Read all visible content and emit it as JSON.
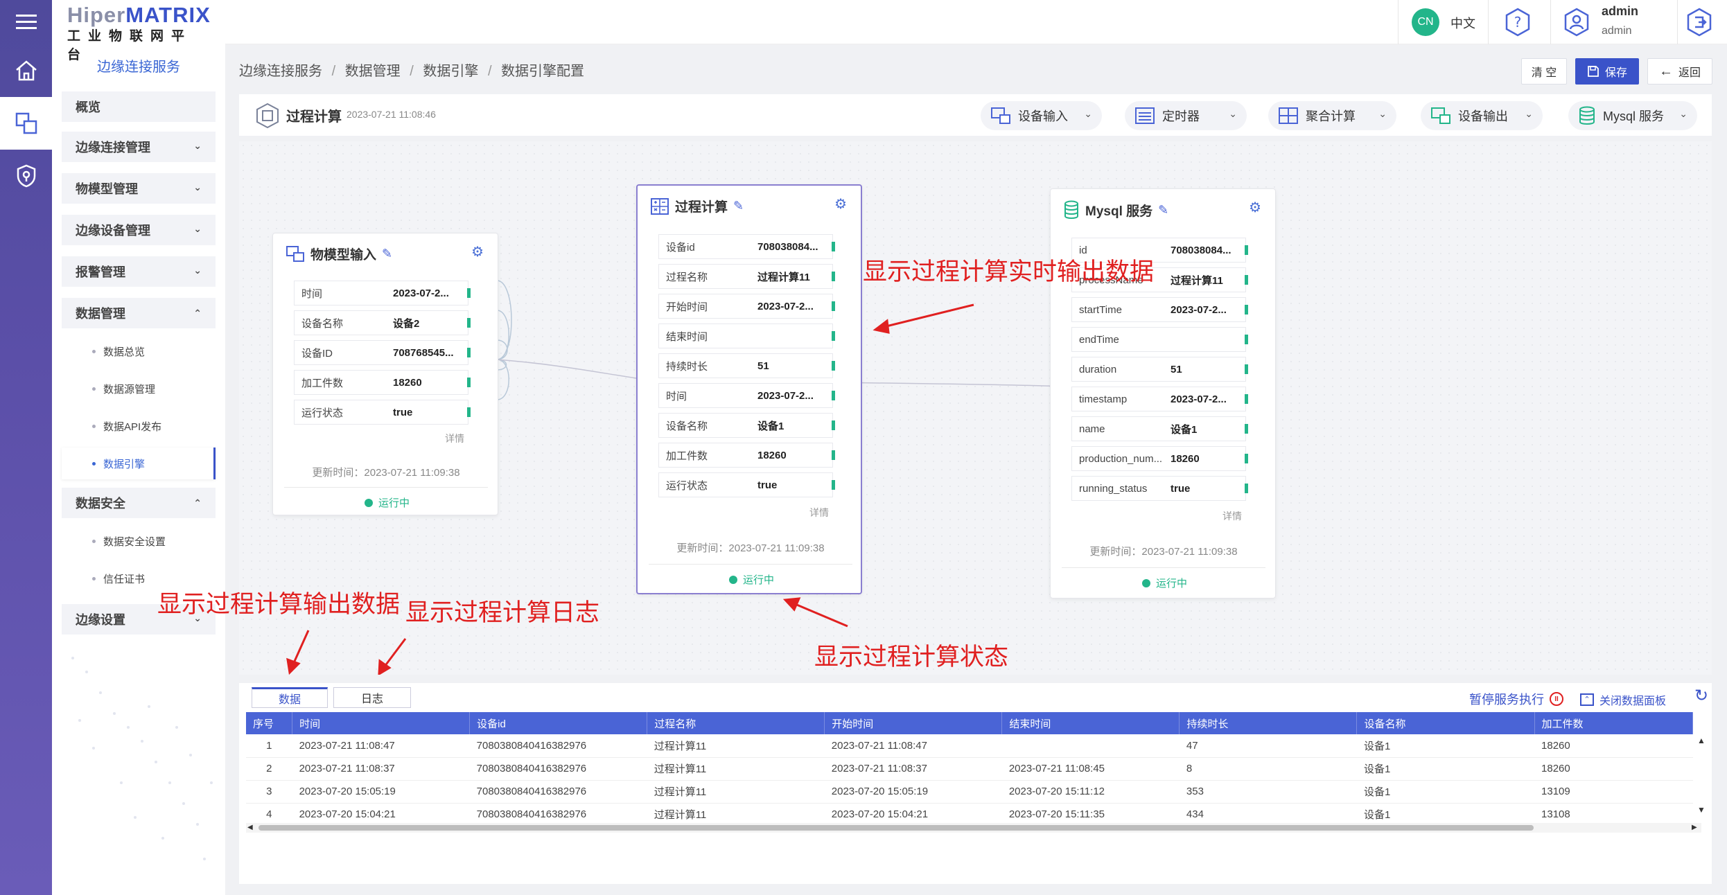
{
  "brand": {
    "name_a": "Hiper",
    "name_b": "MATRIX",
    "subtitle": "工业物联网平台"
  },
  "sidebar": {
    "service_title": "边缘连接服务",
    "items": [
      {
        "label": "概览"
      },
      {
        "label": "边缘连接管理"
      },
      {
        "label": "物模型管理"
      },
      {
        "label": "边缘设备管理"
      },
      {
        "label": "报警管理"
      },
      {
        "label": "数据管理"
      },
      {
        "label": "数据安全"
      },
      {
        "label": "边缘设置"
      }
    ],
    "data_sub": [
      {
        "label": "数据总览"
      },
      {
        "label": "数据源管理"
      },
      {
        "label": "数据API发布"
      },
      {
        "label": "数据引擎"
      }
    ],
    "sec_sub": [
      {
        "label": "数据安全设置"
      },
      {
        "label": "信任证书"
      }
    ]
  },
  "header": {
    "lang_badge": "CN",
    "lang_label": "中文",
    "user_name": "admin",
    "user_role": "admin"
  },
  "breadcrumb": [
    "边缘连接服务",
    "数据管理",
    "数据引擎",
    "数据引擎配置"
  ],
  "breadcrumb_sep": "/",
  "toolbar": {
    "clear": "清 空",
    "save": "保存",
    "back": "返回"
  },
  "flow": {
    "title": "过程计算",
    "timestamp": "2023-07-21 11:08:46"
  },
  "dropdowns": [
    {
      "label": "设备输入"
    },
    {
      "label": "定时器"
    },
    {
      "label": "聚合计算"
    },
    {
      "label": "设备输出"
    },
    {
      "label": "Mysql 服务"
    }
  ],
  "nodes": {
    "input": {
      "title": "物模型输入",
      "detail": "详情",
      "updated": "更新时间：2023-07-21 11:09:38",
      "status": "运行中",
      "rows": [
        {
          "k": "时间",
          "v": "2023-07-2..."
        },
        {
          "k": "设备名称",
          "v": "设备2"
        },
        {
          "k": "设备ID",
          "v": "708768545..."
        },
        {
          "k": "加工件数",
          "v": "18260"
        },
        {
          "k": "运行状态",
          "v": "true"
        }
      ]
    },
    "calc": {
      "title": "过程计算",
      "detail": "详情",
      "updated": "更新时间：2023-07-21 11:09:38",
      "status": "运行中",
      "rows": [
        {
          "k": "设备id",
          "v": "708038084..."
        },
        {
          "k": "过程名称",
          "v": "过程计算11"
        },
        {
          "k": "开始时间",
          "v": "2023-07-2..."
        },
        {
          "k": "结束时间",
          "v": ""
        },
        {
          "k": "持续时长",
          "v": "51"
        },
        {
          "k": "时间",
          "v": "2023-07-2..."
        },
        {
          "k": "设备名称",
          "v": "设备1"
        },
        {
          "k": "加工件数",
          "v": "18260"
        },
        {
          "k": "运行状态",
          "v": "true"
        }
      ]
    },
    "mysql": {
      "title": "Mysql 服务",
      "detail": "详情",
      "updated": "更新时间：2023-07-21 11:09:38",
      "status": "运行中",
      "rows": [
        {
          "k": "id",
          "v": "708038084..."
        },
        {
          "k": "processName",
          "v": "过程计算11"
        },
        {
          "k": "startTime",
          "v": "2023-07-2..."
        },
        {
          "k": "endTime",
          "v": ""
        },
        {
          "k": "duration",
          "v": "51"
        },
        {
          "k": "timestamp",
          "v": "2023-07-2..."
        },
        {
          "k": "name",
          "v": "设备1"
        },
        {
          "k": "production_num...",
          "v": "18260"
        },
        {
          "k": "running_status",
          "v": "true"
        }
      ]
    }
  },
  "annotations": {
    "realtime": "显示过程计算实时输出数据",
    "output": "显示过程计算输出数据",
    "log": "显示过程计算日志",
    "status": "显示过程计算状态"
  },
  "panel": {
    "tabs": [
      {
        "label": "数据"
      },
      {
        "label": "日志"
      }
    ],
    "pause": "暂停服务执行",
    "close": "关闭数据面板",
    "columns": [
      "序号",
      "时间",
      "设备id",
      "过程名称",
      "开始时间",
      "结束时间",
      "持续时长",
      "设备名称",
      "加工件数"
    ],
    "rows": [
      [
        "1",
        "2023-07-21 11:08:47",
        "7080380840416382976",
        "过程计算11",
        "2023-07-21 11:08:47",
        "",
        "47",
        "设备1",
        "18260"
      ],
      [
        "2",
        "2023-07-21 11:08:37",
        "7080380840416382976",
        "过程计算11",
        "2023-07-21 11:08:37",
        "2023-07-21 11:08:45",
        "8",
        "设备1",
        "18260"
      ],
      [
        "3",
        "2023-07-20 15:05:19",
        "7080380840416382976",
        "过程计算11",
        "2023-07-20 15:05:19",
        "2023-07-20 15:11:12",
        "353",
        "设备1",
        "13109"
      ],
      [
        "4",
        "2023-07-20 15:04:21",
        "7080380840416382976",
        "过程计算11",
        "2023-07-20 15:04:21",
        "2023-07-20 15:11:35",
        "434",
        "设备1",
        "13108"
      ]
    ]
  },
  "colors": {
    "accent": "#3a53c9",
    "running": "#23b58a",
    "annotation": "#e02020"
  }
}
